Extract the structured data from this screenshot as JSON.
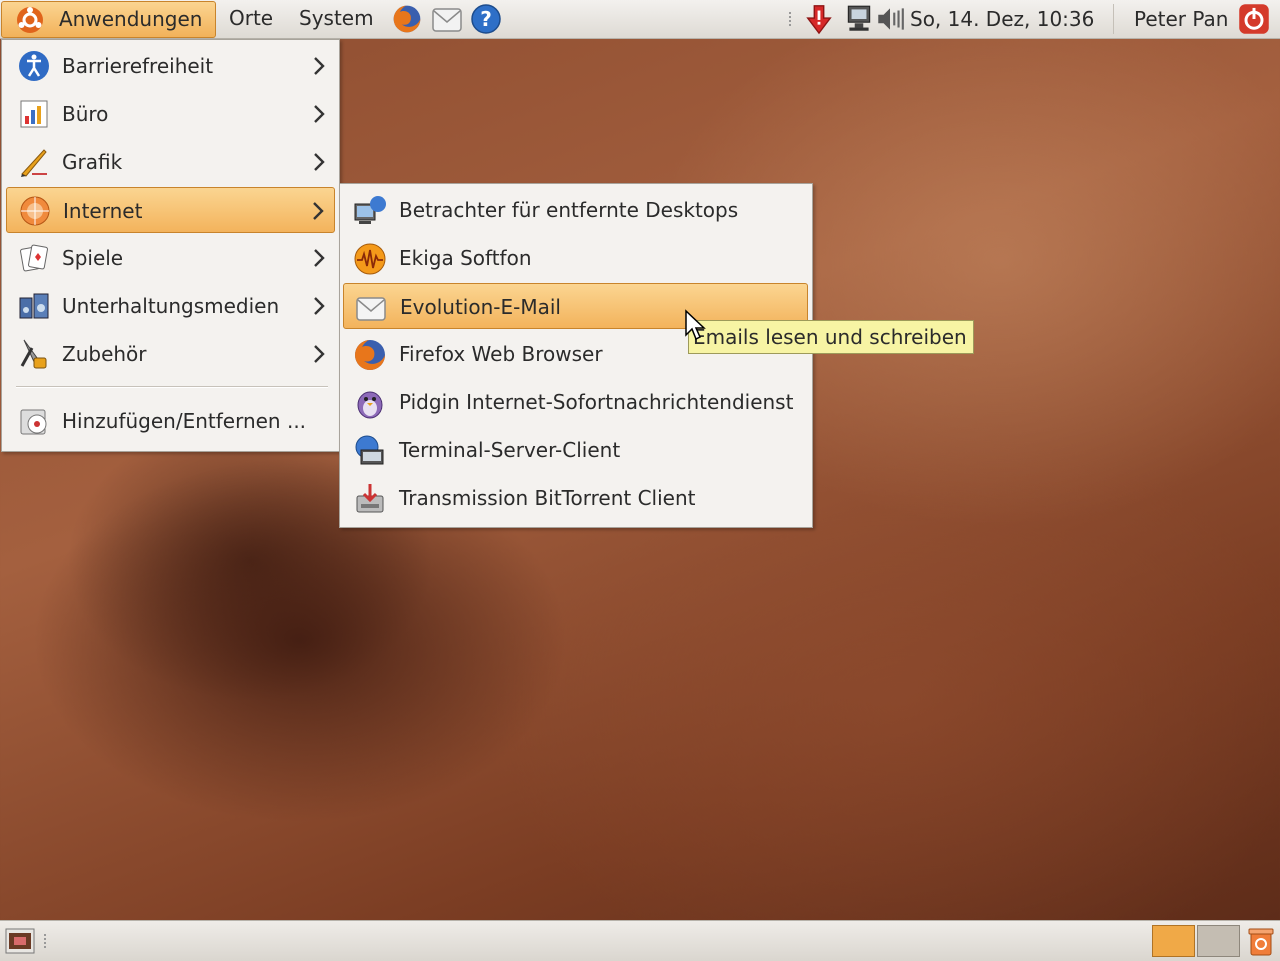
{
  "top_panel": {
    "menus": [
      {
        "label": "Anwendungen",
        "active": true
      },
      {
        "label": "Orte"
      },
      {
        "label": "System"
      }
    ],
    "clock": "So, 14. Dez, 10:36",
    "user": "Peter Pan"
  },
  "applications_menu": {
    "items": [
      {
        "label": "Barrierefreiheit",
        "icon": "accessibility-icon",
        "has_submenu": true
      },
      {
        "label": "Büro",
        "icon": "office-icon",
        "has_submenu": true
      },
      {
        "label": "Grafik",
        "icon": "graphics-icon",
        "has_submenu": true
      },
      {
        "label": "Internet",
        "icon": "internet-icon",
        "has_submenu": true,
        "highlighted": true
      },
      {
        "label": "Spiele",
        "icon": "games-icon",
        "has_submenu": true
      },
      {
        "label": "Unterhaltungsmedien",
        "icon": "multimedia-icon",
        "has_submenu": true
      },
      {
        "label": "Zubehör",
        "icon": "accessories-icon",
        "has_submenu": true
      }
    ],
    "footer_item": {
      "label": "Hinzufügen/Entfernen ...",
      "icon": "add-remove-icon"
    }
  },
  "internet_submenu": {
    "items": [
      {
        "label": "Betrachter für entfernte Desktops",
        "icon": "remote-desktop-icon"
      },
      {
        "label": "Ekiga Softfon",
        "icon": "ekiga-icon"
      },
      {
        "label": "Evolution-E-Mail",
        "icon": "evolution-mail-icon",
        "highlighted": true
      },
      {
        "label": "Firefox Web Browser",
        "icon": "firefox-icon"
      },
      {
        "label": "Pidgin Internet-Sofortnachrichtendienst",
        "icon": "pidgin-icon"
      },
      {
        "label": "Terminal-Server-Client",
        "icon": "terminal-server-icon"
      },
      {
        "label": "Transmission BitTorrent Client",
        "icon": "transmission-icon"
      }
    ]
  },
  "tooltip": "Emails lesen und schreiben",
  "colors": {
    "highlight": "#f3b35c",
    "highlight_border": "#c8842c",
    "tooltip_bg": "#f7f4a4",
    "panel_bg": "#e6e3de"
  }
}
